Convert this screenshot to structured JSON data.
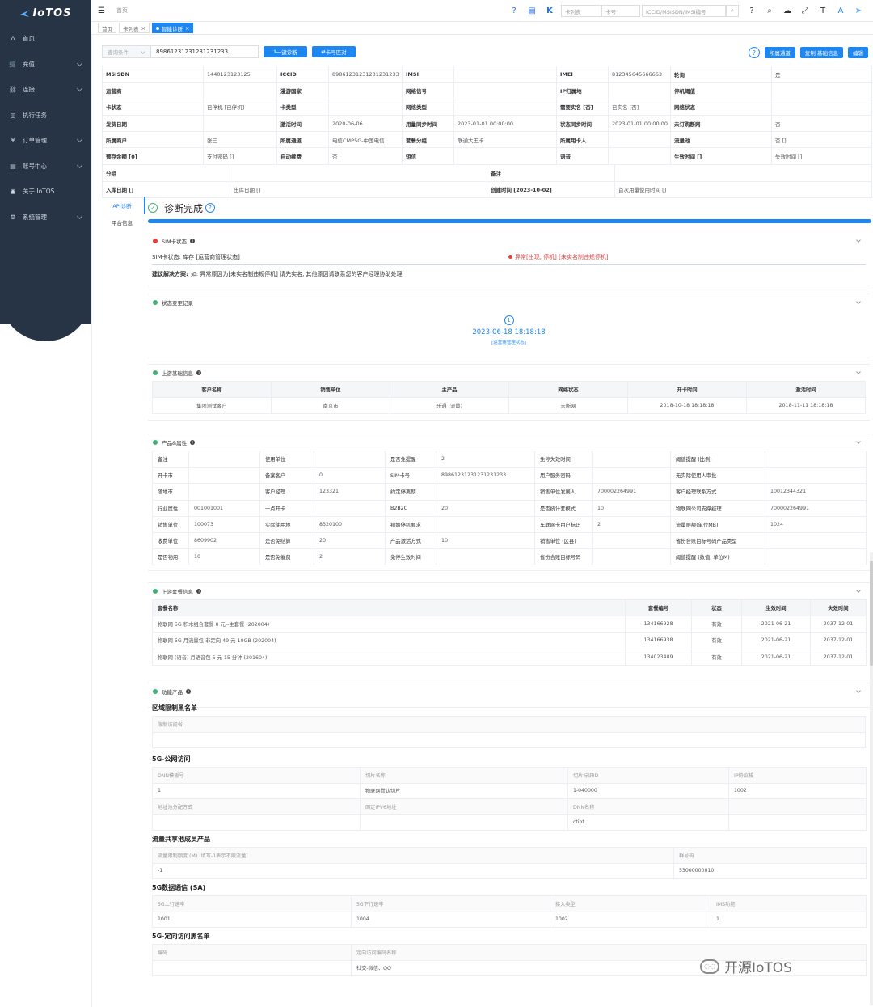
{
  "app": {
    "logo_text": "IoTOS"
  },
  "sidebar": {
    "items": [
      {
        "icon": "home-icon",
        "glyph": "⌂",
        "label": "首页",
        "chevron": false
      },
      {
        "icon": "cart-icon",
        "glyph": "🛒",
        "label": "充值",
        "chevron": true
      },
      {
        "icon": "link-icon",
        "glyph": "⛓",
        "label": "连接",
        "chevron": true
      },
      {
        "icon": "task-icon",
        "glyph": "◎",
        "label": "执行任务",
        "chevron": false
      },
      {
        "icon": "yen-icon",
        "glyph": "¥",
        "label": "订单管理",
        "chevron": true
      },
      {
        "icon": "account-icon",
        "glyph": "▤",
        "label": "账号中心",
        "chevron": true
      },
      {
        "icon": "about-icon",
        "glyph": "◉",
        "label": "关于 IoTOS",
        "chevron": false
      },
      {
        "icon": "gear-icon",
        "glyph": "⚙",
        "label": "系统管理",
        "chevron": true
      }
    ]
  },
  "topbar": {
    "breadcrumb": "首页",
    "select1": "卡列表",
    "select2": "卡号",
    "search_placeholder": "ICCID/MSISDN/IMSI编号"
  },
  "tags": [
    {
      "label": "首页",
      "active": false,
      "closable": false
    },
    {
      "label": "卡列表",
      "active": false,
      "closable": true
    },
    {
      "label": "智能诊断",
      "active": true,
      "closable": true
    }
  ],
  "search": {
    "condition_placeholder": "查询条件",
    "value": "89861231231231231233",
    "btn_diagnose": "一键诊断",
    "btn_compare": "卡号匹对",
    "btn_channel": "所属通道",
    "btn_copy": "复制 基础信息",
    "btn_edit": "编辑"
  },
  "info_rows": [
    [
      "MSISDN",
      "1440123123125",
      "ICCID",
      "89861231231231231233",
      "IMSI",
      "",
      "IMEI",
      "812345645666663",
      "轮询",
      "是"
    ],
    [
      "运营商",
      "",
      "漫游国家",
      "",
      "网络信号",
      "",
      "IP归属地",
      "",
      "停机阈值",
      ""
    ],
    [
      "卡状态",
      "已停机 [已停机]",
      "卡类型",
      "",
      "网络类型",
      "",
      "需要实名 [否]",
      "已实名 [否]",
      "网络状态",
      ""
    ],
    [
      "发货日期",
      "",
      "激活时间",
      "2020-06-06",
      "用量同步时间",
      "2023-01-01 00:00:00",
      "状态同步时间",
      "2023-01-01 00:00:00",
      "未订购断网",
      "否"
    ],
    [
      "所属商户",
      "张三",
      "所属通道",
      "电信CMP5G-中国电信",
      "套餐分组",
      "联通大王卡",
      "所属用卡人",
      "",
      "流量池",
      "否 []"
    ],
    [
      "预存余额 [0]",
      "支付密码 []",
      "自动续费",
      "否",
      "短信",
      "",
      "语音",
      "",
      "生效时间 []",
      "失效时间 []"
    ]
  ],
  "info_rows2": [
    [
      "分组",
      "",
      "备注",
      ""
    ],
    [
      "入库日期 []",
      "出库日期 []",
      "创建时间 [2023-10-02]",
      "首次用量使用时间 []"
    ]
  ],
  "diag": {
    "tabs": [
      "API诊断",
      "平台信息"
    ],
    "title": "诊断完成",
    "progress": 100
  },
  "sim_status": {
    "title": "SIM卡状态",
    "status_text": "SIM卡状态: 库存 [运营商管理状态]",
    "error_text": "异常[出现, 停机] [未实名制违规停机]",
    "suggestion_label": "建议解决方案:",
    "suggestion_text": "如: 异常原因为[未实名制违规停机] 请先实名, 其他原因请联系您的客户经理协助处理"
  },
  "state_change": {
    "title": "状态变更记录",
    "step": "1",
    "time": "2023-06-18 18:18:18",
    "desc": "[运营商管理状态]"
  },
  "upstream_basic": {
    "title": "上游基础信息",
    "headers": [
      "客户名称",
      "销售单位",
      "主产品",
      "网络状态",
      "开卡时间",
      "激活时间"
    ],
    "row": [
      "集团测试客户",
      "南京市",
      "乐通 (流量)",
      "未断网",
      "2018-10-18 18:18:18",
      "2018-11-11 18:18:18"
    ]
  },
  "product_attr": {
    "title": "产品&属性",
    "rows": [
      [
        "备注",
        "",
        "使用单位",
        "",
        "是否免提醒",
        "2",
        "免停失效时间",
        "",
        "阈值提醒 (比例)",
        ""
      ],
      [
        "开卡市",
        "",
        "备案客户",
        "0",
        "SIM卡号",
        "89861231231231231233",
        "用户服务密码",
        "",
        "无实际使用人审批",
        ""
      ],
      [
        "落地市",
        "",
        "客户经理",
        "123321",
        "约定停离期",
        "",
        "销售单位发展人",
        "700002264991",
        "客户经理联系方式",
        "10012344321"
      ],
      [
        "行业属性",
        "001001001",
        "一点开卡",
        "",
        "B2B2C",
        "20",
        "是否统计套模式",
        "10",
        "物联网公司支撑经理",
        "700002264991"
      ],
      [
        "销售单位",
        "100073",
        "实际使用地",
        "8320100",
        "初始停机要求",
        "",
        "车联网卡用户标识",
        "2",
        "流量限额(单位MB)",
        "1024"
      ],
      [
        "收费单位",
        "8609902",
        "是否免结算",
        "20",
        "产品激活方式",
        "10",
        "销售单位 (区县)",
        "",
        "省份合账目标号码产品类型",
        ""
      ],
      [
        "是否物用",
        "10",
        "是否免催费",
        "2",
        "免停生效时间",
        "",
        "省份合账目标号码",
        "",
        "阈值提醒 (数值, 单位M)",
        ""
      ]
    ]
  },
  "upstream_plan": {
    "title": "上游套餐信息",
    "headers": [
      "套餐名称",
      "套餐编号",
      "状态",
      "生效时间",
      "失效时间"
    ],
    "rows": [
      [
        "物联网 5G 积木组合套餐 0 元--主套餐 (202004)",
        "134166928",
        "有效",
        "2021-06-21",
        "2037-12-01"
      ],
      [
        "物联网 5G 月流量包-非定向 49 元 10GB (202004)",
        "134166938",
        "有效",
        "2021-06-21",
        "2037-12-01"
      ],
      [
        "物联网 (语音) 月语音包 5 元 15 分钟 (201604)",
        "134023409",
        "有效",
        "2021-06-21",
        "2037-12-01"
      ]
    ]
  },
  "func_products": {
    "title": "功能产品",
    "area_blacklist": {
      "title": "区域限制黑名单",
      "header": "限制访问省"
    },
    "public_5g": {
      "title": "5G-公网访问",
      "h1": [
        "DNN模板号",
        "切片名称",
        "切片标识ID",
        "IP协议栈"
      ],
      "r1": [
        "1",
        "物联网默认切片",
        "1-040000",
        "1002"
      ],
      "h2": [
        "地址池分配方式",
        "固定IPV6地址",
        "DNN名称",
        ""
      ],
      "r2": [
        "",
        "",
        "ctiot",
        ""
      ]
    },
    "pool": {
      "title": "流量共享池成员产品",
      "h": [
        "流量限制额度 (M) (填写-1表示不限流量)",
        "群号码"
      ],
      "r": [
        "-1",
        "53000000010"
      ]
    },
    "sa_5g": {
      "title": "5G数据通信 (SA)",
      "h": [
        "5G上行速率",
        "5G下行速率",
        "接入类型",
        "IMS功能"
      ],
      "r": [
        "1001",
        "1004",
        "1002",
        "1"
      ]
    },
    "directed_blacklist": {
      "title": "5G-定向访问黑名单",
      "h": [
        "编码",
        "定向访问编码名称"
      ],
      "r": [
        "",
        "社交-微信、QQ"
      ]
    }
  },
  "watermark": "开源IoTOS"
}
